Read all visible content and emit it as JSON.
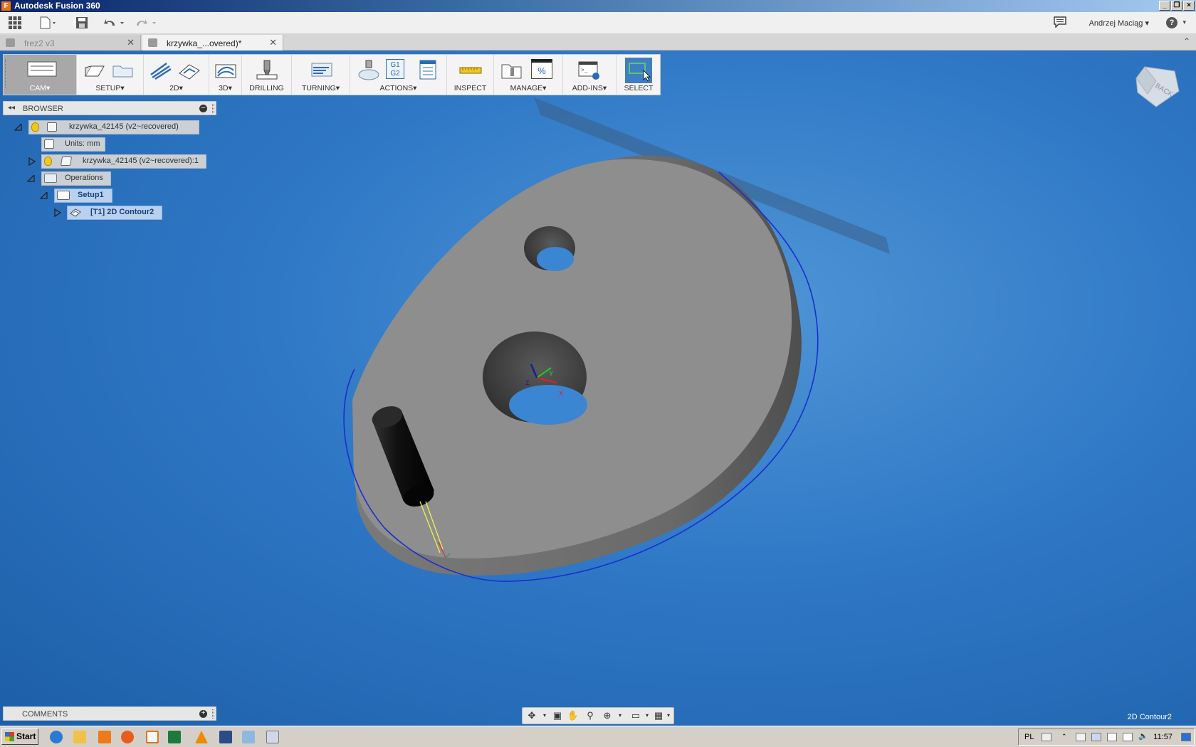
{
  "window": {
    "title": "Autodesk Fusion 360"
  },
  "appbar": {
    "user": "Andrzej Maciąg",
    "help": "?"
  },
  "tabs": [
    {
      "label": "frez2 v3",
      "active": false
    },
    {
      "label": "krzywka_...overed)*",
      "active": true
    }
  ],
  "toolbar": {
    "workspace": "CAM▾",
    "groups": [
      "SETUP▾",
      "2D▾",
      "3D▾",
      "DRILLING",
      "TURNING▾",
      "ACTIONS▾",
      "INSPECT",
      "MANAGE▾",
      "ADD-INS▾",
      "SELECT"
    ]
  },
  "actions_icon_text": {
    "line1": "G1",
    "line2": "G2"
  },
  "manage_icon_text": "%",
  "browser": {
    "title": "BROWSER",
    "root": "krzywka_42145 (v2~recovered)",
    "units": "Units: mm",
    "component": "krzywka_42145 (v2~recovered):1",
    "operations": "Operations",
    "setup": "Setup1",
    "operation": "[T1] 2D Contour2"
  },
  "comments": {
    "title": "COMMENTS"
  },
  "viewcube": {
    "face": "BACK"
  },
  "axes": {
    "x": "X",
    "y": "Y",
    "z": "Z"
  },
  "status": {
    "active_operation": "2D Contour2"
  },
  "taskbar": {
    "start": "Start",
    "lang": "PL",
    "clock": "11:57"
  },
  "colors": {
    "viewport": "#2f78c6",
    "part": "#8e8e8e",
    "toolpath": "#1a2fd0"
  }
}
